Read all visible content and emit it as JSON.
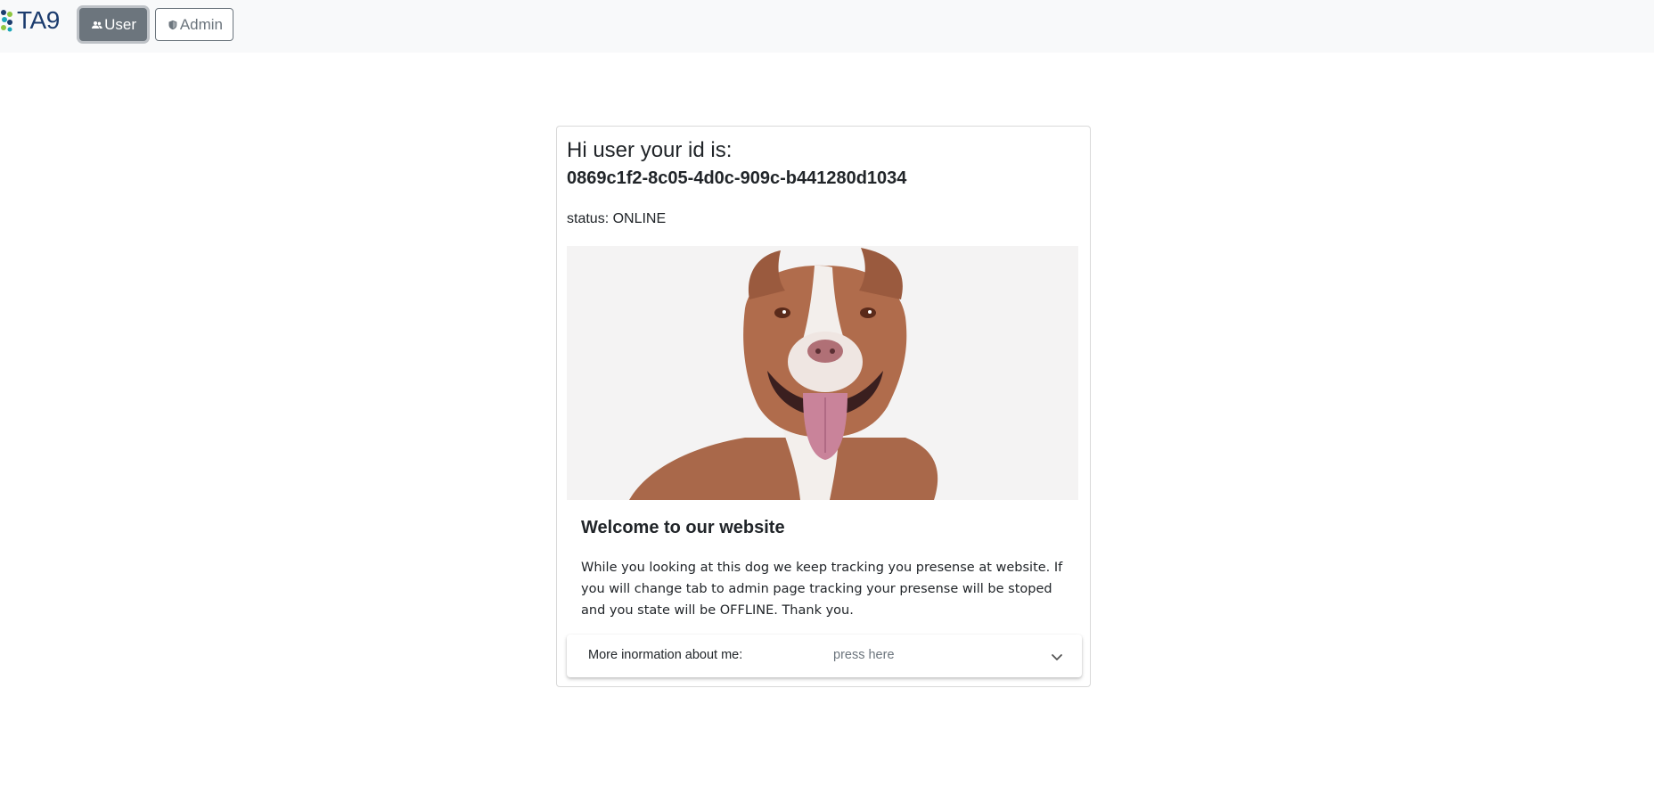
{
  "navbar": {
    "logo_text": "TA9",
    "user_button_label": "User",
    "admin_button_label": "Admin",
    "user_icon": "users-icon",
    "admin_icon": "shield-icon"
  },
  "card": {
    "greeting": "Hi user your id is:",
    "user_id": "0869c1f2-8c05-4d0c-909c-b441280d1034",
    "status": "status: ONLINE",
    "welcome_title": "Welcome to our website",
    "welcome_text": "While you looking at this dog we keep tracking you presense at website. If you will change tab to admin page tracking your presense will be stoped and you state will be OFFLINE. Thank you.",
    "expander": {
      "label": "More inormation about me:",
      "hint": "press here",
      "icon": "chevron-down-icon"
    }
  },
  "colors": {
    "navbar_bg": "#f8f9fa",
    "secondary": "#6c757d",
    "logo": "#1b3c6e"
  }
}
